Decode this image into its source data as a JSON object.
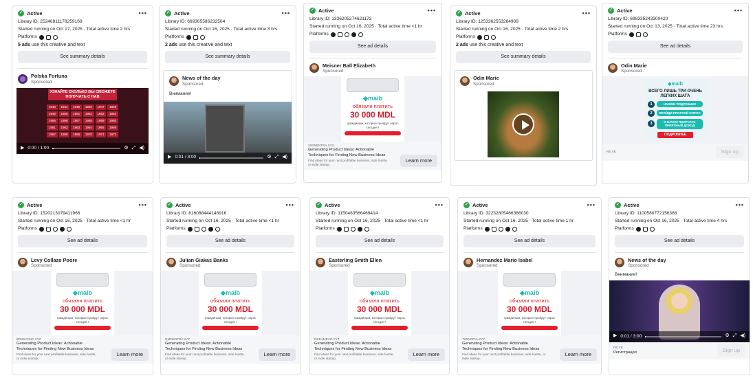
{
  "common": {
    "status": "Active",
    "sponsored": "Sponsored",
    "platforms_label": "Platforms",
    "see_ad_details": "See ad details",
    "see_summary_details": "See summary details",
    "more": "•••",
    "ads_suffix": "use this creative and text"
  },
  "maib_creative": {
    "logo_prefix": "",
    "logo": "maib",
    "sub": "обязали платить",
    "amount": "30 000 MDL",
    "small": "граждиным, которые пройдут опрос сегодня !",
    "domain": "VIEWENTRA.XYZ",
    "headline": "Generating Product Ideas: Actionable Techniques for Finding New Business Ideas",
    "description": "Find ideas for your next profitable business, side hustle, or indie startup.",
    "cta": "Learn more"
  },
  "cards": [
    {
      "library_id": "Library ID: 25246811178259169",
      "started": "Started running on Oct 17, 2025 · Total active time 2 hrs",
      "ads_count": "5 ads",
      "advertiser": "Polska Fortuna",
      "video_time": "0:00 / 1:00"
    },
    {
      "library_id": "Library ID: 669365586232504",
      "started": "Started running on Oct 16, 2025 · Total active time 3 hrs",
      "ads_count": "2 ads",
      "advertiser": "News of the day",
      "body": "Внимание!",
      "video_time": "0:01 / 3:00"
    },
    {
      "library_id": "Library ID: 1336205274621173",
      "started": "Started running on Oct 16, 2025 · Total active time <1 hr",
      "advertiser": "Meisner Ball Elizabeth"
    },
    {
      "library_id": "Library ID: 1253362553264909",
      "started": "Started running on Oct 16, 2025 · Total active time 2 hrs",
      "ads_count": "2 ads",
      "advertiser": "Odin Marie"
    },
    {
      "library_id": "Library ID: 698335243300420",
      "started": "Started running on Oct 13, 2025 · Total active time 23 hrs",
      "advertiser": "Odin Marie",
      "domain": "RE.VE",
      "cta": "Sign up"
    },
    {
      "library_id": "Library ID: 1520213079411966",
      "started": "Started running on Oct 16, 2025 · Total active time <1 hr",
      "advertiser": "Levy Collazo Poore",
      "domain": "BRIGHTINC.XYZ"
    },
    {
      "library_id": "Library ID: 816088444146916",
      "started": "Started running on Oct 16, 2025 · Total active time <1 hr",
      "advertiser": "Julian Giakas Banks",
      "domain": "OMOENTRY.XYZ"
    },
    {
      "library_id": "Library ID: 1150483566469414",
      "started": "Started running on Oct 16, 2025 · Total active time <1 hr",
      "advertiser": "Easterling Smith Ellen",
      "domain": "DREAMEVO.XYZ"
    },
    {
      "library_id": "Library ID: 32232805466366030",
      "started": "Started running on Oct 16, 2025 · Total active time 1 hr",
      "advertiser": "Hernandez Mario Isabel",
      "domain": "TWINOPIA.XYZ"
    },
    {
      "library_id": "Library ID: 1100580772156368",
      "started": "Started running on Oct 16, 2025 · Total active time 4 hrs",
      "advertiser": "News of the day",
      "body": "Внимание!",
      "video_time": "0:01 / 3:00",
      "domain": "RE.VE",
      "caption": "Регистрация",
      "cta": "Sign up"
    }
  ],
  "steps_creative": {
    "logo": "maib",
    "headline": "ВСЕГО ЛИШЬ ТРИ ОЧЕНЬ ЛЕГКИХ ШАГА",
    "steps": [
      "НАЖМИ ПОДРОБНЕЕ",
      "ПРОЙДИ ПРОСТОЙ ОПРОС",
      "И НАЧНИ ПОЛУЧАТЬ ПРИЯТНЫЙ ДОХОД"
    ],
    "button": "ПОДРОБНЕЕ"
  },
  "polska_creative": {
    "headline": "УЗНАЙТЕ СКОЛЬКО ВЫ СМОЖЕТЕ ПОЛУЧАТЬ С НАВ",
    "years": [
      "1943",
      "1944",
      "1945",
      "1946",
      "1947",
      "1948",
      "1949",
      "1950",
      "1951",
      "1952",
      "1953",
      "1954",
      "1955",
      "1956",
      "1957",
      "1958",
      "1959",
      "1960",
      "1961",
      "1962",
      "1963",
      "1964",
      "1965",
      "1966",
      "1967",
      "1968",
      "1969",
      "1970",
      "1971",
      "1972"
    ]
  }
}
